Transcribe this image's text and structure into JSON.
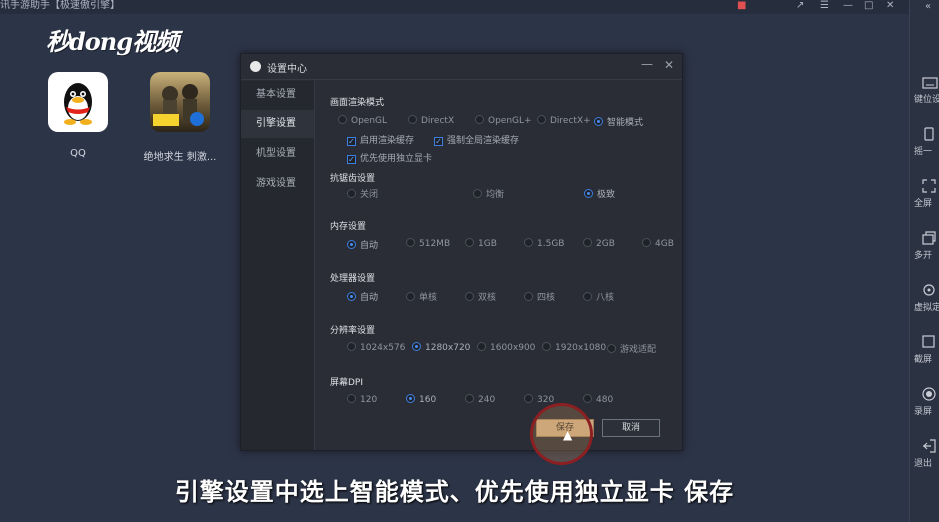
{
  "window": {
    "title": "讯手游助手【极速傲引擎】",
    "controls": [
      "gift-icon",
      "popout-icon",
      "menu-icon",
      "minimize-icon",
      "maximize-icon",
      "close-icon"
    ]
  },
  "brand": {
    "text": "秒dong视频"
  },
  "apps": [
    {
      "label": "QQ",
      "icon": "qq-penguin-icon"
    },
    {
      "label": "绝地求生 刺激...",
      "icon": "pubg-game-icon"
    }
  ],
  "right_sidebar": {
    "collapse_icon": "double-chevron-left-icon",
    "items": [
      {
        "label": "键位设",
        "icon": "keyboard-icon"
      },
      {
        "label": "摇一",
        "icon": "shake-icon"
      },
      {
        "label": "全屏",
        "icon": "fullscreen-icon"
      },
      {
        "label": "多开",
        "icon": "multi-instance-icon"
      },
      {
        "label": "虚拟定",
        "icon": "location-icon"
      },
      {
        "label": "截屏",
        "icon": "screenshot-icon"
      },
      {
        "label": "录屏",
        "icon": "record-icon"
      },
      {
        "label": "退出",
        "icon": "exit-icon"
      }
    ]
  },
  "dialog": {
    "title": "设置中心",
    "nav": [
      {
        "label": "基本设置",
        "active": false
      },
      {
        "label": "引擎设置",
        "active": true
      },
      {
        "label": "机型设置",
        "active": false
      },
      {
        "label": "游戏设置",
        "active": false
      }
    ],
    "render": {
      "title": "画面渲染模式",
      "options": [
        "OpenGL",
        "DirectX",
        "OpenGL+",
        "DirectX+",
        "智能模式"
      ],
      "selected": "智能模式",
      "checkboxes": [
        {
          "label": "启用渲染缓存",
          "checked": true
        },
        {
          "label": "强制全局渲染缓存",
          "checked": true
        },
        {
          "label": "优先使用独立显卡",
          "checked": true
        }
      ]
    },
    "antialias": {
      "title": "抗锯齿设置",
      "options": [
        "关闭",
        "均衡",
        "极致"
      ],
      "selected": "极致"
    },
    "memory": {
      "title": "内存设置",
      "options": [
        "自动",
        "512MB",
        "1GB",
        "1.5GB",
        "2GB",
        "4GB"
      ],
      "selected": "自动"
    },
    "cpu": {
      "title": "处理器设置",
      "options": [
        "自动",
        "单核",
        "双核",
        "四核",
        "八核"
      ],
      "selected": "自动"
    },
    "resolution": {
      "title": "分辨率设置",
      "options": [
        "1024x576",
        "1280x720",
        "1600x900",
        "1920x1080",
        "游戏适配"
      ],
      "selected": "1280x720"
    },
    "dpi": {
      "title": "屏幕DPI",
      "options": [
        "120",
        "160",
        "240",
        "320",
        "480"
      ],
      "selected": "160"
    },
    "buttons": {
      "save": "保存",
      "cancel": "取消"
    }
  },
  "caption": "引擎设置中选上智能模式、优先使用独立显卡 保存",
  "colors": {
    "accent": "#4a8cf0",
    "highlight_ring": "#8c1f22",
    "save_button": "#c9a880"
  }
}
